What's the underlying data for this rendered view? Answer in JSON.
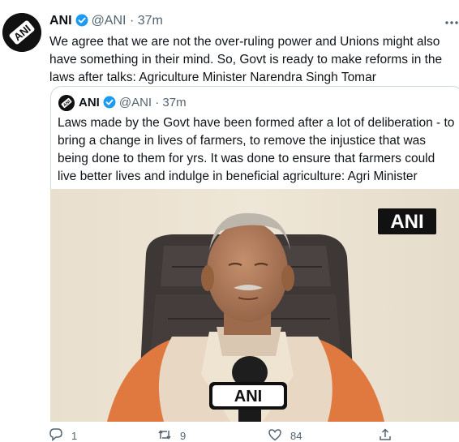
{
  "tweet": {
    "display_name": "ANI",
    "handle": "@ANI",
    "separator": "·",
    "time": "37m",
    "text": "We agree that we are not the over-ruling power and Unions might also have something in their mind. So, Govt is ready to make reforms in the laws after talks: Agriculture Minister Narendra Singh Tomar"
  },
  "quoted_tweet": {
    "display_name": "ANI",
    "handle": "@ANI",
    "separator": "·",
    "time": "37m",
    "text": "Laws made by the Govt have been formed after a lot of deliberation - to bring a change in lives of farmers, to remove the injustice that was being done to them for yrs. It was done to ensure that farmers could live better lives and indulge in beneficial agriculture: Agri Minister",
    "watermark": "ANI",
    "mic_label": "ANI"
  },
  "actions": {
    "reply_count": "1",
    "retweet_count": "9",
    "like_count": "84"
  },
  "colors": {
    "verified": "#1d9bf0",
    "muted_text": "#536471",
    "border": "#cfd9de"
  },
  "icons": [
    "verified-badge-icon",
    "more-options-icon",
    "reply-icon",
    "retweet-icon",
    "like-icon",
    "share-icon"
  ]
}
